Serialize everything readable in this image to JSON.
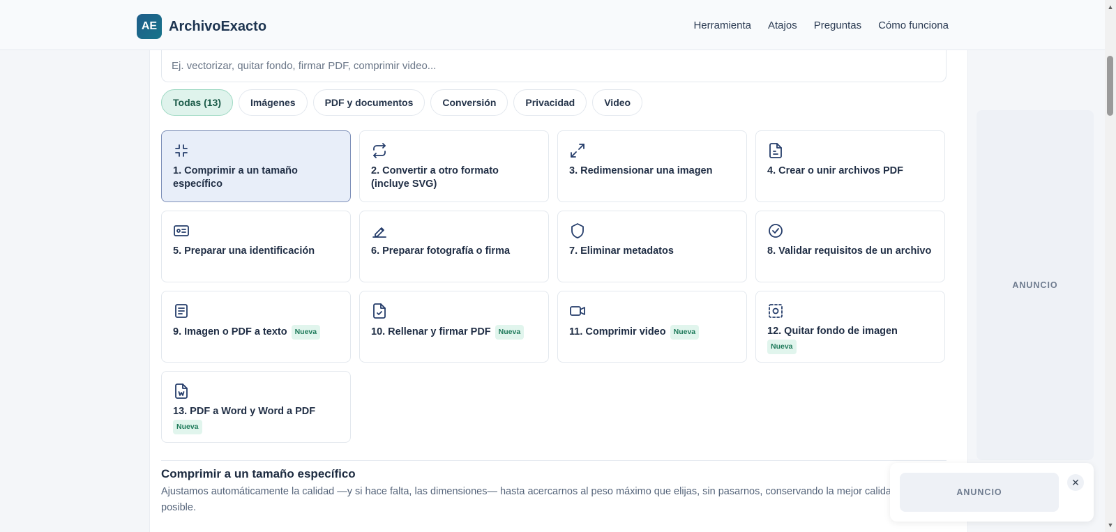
{
  "header": {
    "logo_text": "AE",
    "brand": "ArchivoExacto",
    "nav": [
      "Herramienta",
      "Atajos",
      "Preguntas",
      "Cómo funciona"
    ]
  },
  "search": {
    "placeholder": "Ej. vectorizar, quitar fondo, firmar PDF, comprimir video..."
  },
  "filters": [
    {
      "label": "Todas (13)",
      "active": true
    },
    {
      "label": "Imágenes",
      "active": false
    },
    {
      "label": "PDF y documentos",
      "active": false
    },
    {
      "label": "Conversión",
      "active": false
    },
    {
      "label": "Privacidad",
      "active": false
    },
    {
      "label": "Video",
      "active": false
    }
  ],
  "tools": [
    {
      "title": "1. Comprimir a un tamaño específico",
      "icon": "compress-icon",
      "badge": "",
      "selected": true
    },
    {
      "title": "2. Convertir a otro formato (incluye SVG)",
      "icon": "convert-icon",
      "badge": ""
    },
    {
      "title": "3. Redimensionar una imagen",
      "icon": "resize-icon",
      "badge": ""
    },
    {
      "title": "4. Crear o unir archivos PDF",
      "icon": "file-icon",
      "badge": ""
    },
    {
      "title": "5. Preparar una identificación",
      "icon": "id-card-icon",
      "badge": ""
    },
    {
      "title": "6. Preparar fotografía o firma",
      "icon": "signature-icon",
      "badge": ""
    },
    {
      "title": "7. Eliminar metadatos",
      "icon": "shield-icon",
      "badge": ""
    },
    {
      "title": "8. Validar requisitos de un archivo",
      "icon": "check-circle-icon",
      "badge": ""
    },
    {
      "title": "9. Imagen o PDF a texto",
      "icon": "text-document-icon",
      "badge": "Nueva"
    },
    {
      "title": "10. Rellenar y firmar PDF",
      "icon": "file-check-icon",
      "badge": "Nueva"
    },
    {
      "title": "11. Comprimir video",
      "icon": "video-icon",
      "badge": "Nueva"
    },
    {
      "title": "12. Quitar fondo de imagen",
      "icon": "background-remove-icon",
      "badge": "Nueva"
    },
    {
      "title": "13. PDF a Word y Word a PDF",
      "icon": "word-file-icon",
      "badge": "Nueva"
    }
  ],
  "section": {
    "title": "Comprimir a un tamaño específico",
    "description": "Ajustamos automáticamente la calidad —y si hace falta, las dimensiones— hasta acercarnos al peso máximo que elijas, sin pasarnos, conservando la mejor calidad posible."
  },
  "ads": {
    "side_label": "ANUNCIO",
    "popup_label": "ANUNCIO",
    "close_symbol": "✕"
  },
  "colors": {
    "brand": "#1f5d8a",
    "chip_active_bg": "#dff3ec",
    "card_selected_bg": "#e8eef9",
    "badge_text": "#1e7a5a"
  }
}
